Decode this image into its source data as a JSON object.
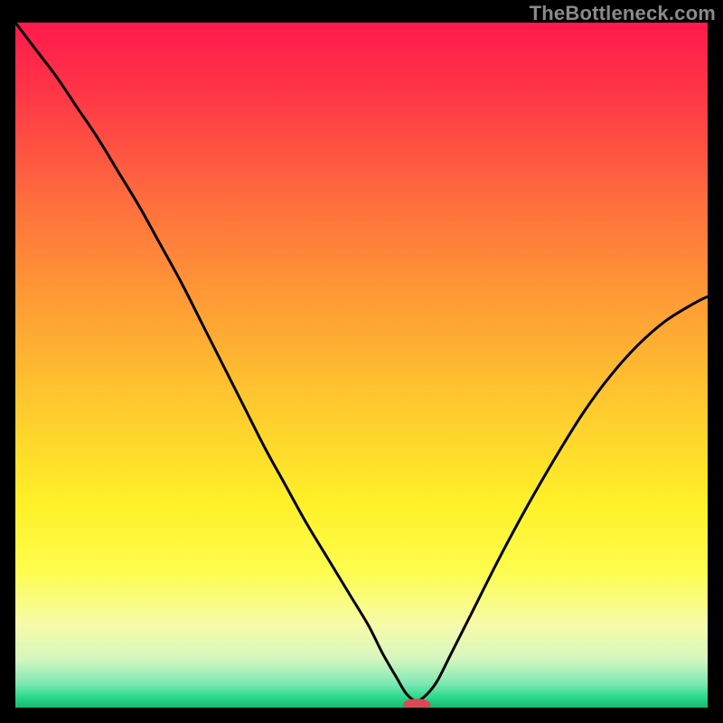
{
  "watermark": "TheBottleneck.com",
  "chart_data": {
    "type": "line",
    "title": "",
    "xlabel": "",
    "ylabel": "",
    "xlim": [
      0,
      100
    ],
    "ylim": [
      0,
      100
    ],
    "grid": false,
    "legend": false,
    "gradient_stops": [
      {
        "offset": 0.0,
        "color": "#ff1a4d"
      },
      {
        "offset": 0.1,
        "color": "#ff3547"
      },
      {
        "offset": 0.25,
        "color": "#ff6a3e"
      },
      {
        "offset": 0.4,
        "color": "#ff9a36"
      },
      {
        "offset": 0.55,
        "color": "#ffc72f"
      },
      {
        "offset": 0.7,
        "color": "#fff028"
      },
      {
        "offset": 0.8,
        "color": "#fdfd4e"
      },
      {
        "offset": 0.88,
        "color": "#f7fbaa"
      },
      {
        "offset": 0.93,
        "color": "#d4f6c0"
      },
      {
        "offset": 0.965,
        "color": "#7de8b4"
      },
      {
        "offset": 0.985,
        "color": "#29d98c"
      },
      {
        "offset": 1.0,
        "color": "#18b86f"
      }
    ],
    "series": [
      {
        "name": "bottleneck-curve",
        "x": [
          0.0,
          3.0,
          6.0,
          9.0,
          12.0,
          15.0,
          18.0,
          21.0,
          24.0,
          27.0,
          30.0,
          33.0,
          36.0,
          39.0,
          42.0,
          45.0,
          48.0,
          51.0,
          53.0,
          55.0,
          56.5,
          58.0,
          59.5,
          61.0,
          63.0,
          66.0,
          70.0,
          74.0,
          78.0,
          82.0,
          86.0,
          90.0,
          94.0,
          98.0,
          100.0
        ],
        "y": [
          100.0,
          96.0,
          92.0,
          87.5,
          83.0,
          78.0,
          73.0,
          67.5,
          62.0,
          56.0,
          50.0,
          44.0,
          38.0,
          32.5,
          27.0,
          22.0,
          17.0,
          12.0,
          8.0,
          4.5,
          2.0,
          1.0,
          2.0,
          4.0,
          8.0,
          14.0,
          22.0,
          29.5,
          36.5,
          43.0,
          48.5,
          53.0,
          56.5,
          59.0,
          60.0
        ]
      }
    ],
    "marker": {
      "x": 58.0,
      "y": 0.5,
      "color": "#d94a55",
      "rx": 2.0,
      "ry": 0.8
    }
  }
}
